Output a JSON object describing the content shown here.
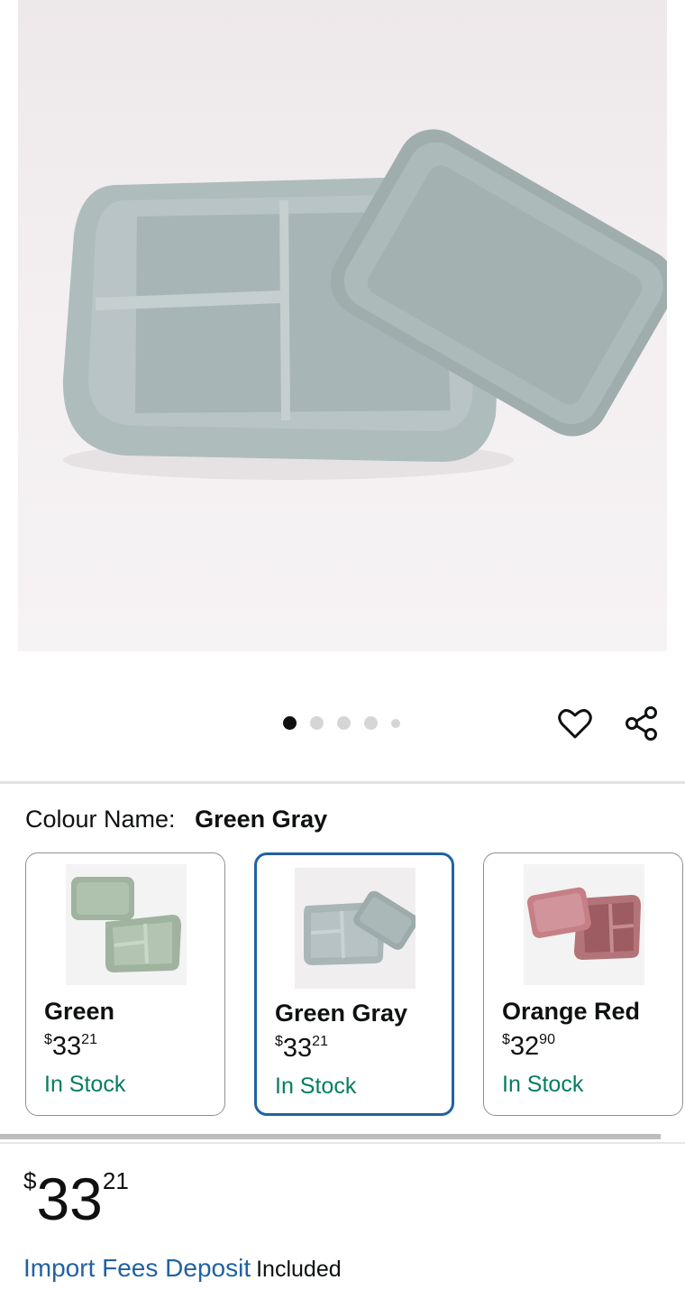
{
  "product": {
    "image_alt": "Silicone bento lunch box with lid, green gray",
    "carousel": {
      "total": 5,
      "active_index": 0
    }
  },
  "actions": {
    "favorite_icon": "heart-icon",
    "share_icon": "share-icon"
  },
  "colour": {
    "label": "Colour Name:",
    "selected": "Green Gray"
  },
  "swatches": [
    {
      "name": "Green",
      "price_currency": "$",
      "price_whole": "33",
      "price_fraction": "21",
      "stock": "In Stock",
      "color": "#a7b9a6"
    },
    {
      "name": "Green Gray",
      "price_currency": "$",
      "price_whole": "33",
      "price_fraction": "21",
      "stock": "In Stock",
      "color": "#aab6b4"
    },
    {
      "name": "Orange Red",
      "price_currency": "$",
      "price_whole": "32",
      "price_fraction": "90",
      "stock": "In Stock",
      "color": "#c98b90"
    }
  ],
  "price": {
    "currency": "$",
    "whole": "33",
    "fraction": "21"
  },
  "import": {
    "link": "Import Fees Deposit",
    "suffix": "Included"
  },
  "colors": {
    "link": "#2162a1",
    "in_stock": "#067d62",
    "selected_border": "#2162a1"
  }
}
